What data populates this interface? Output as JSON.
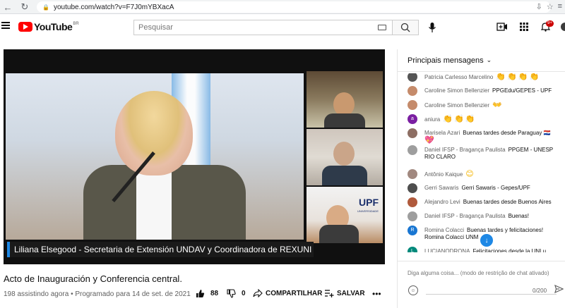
{
  "browser": {
    "url": "youtube.com/watch?v=F7J0mYBXacA"
  },
  "header": {
    "logo_text": "YouTube",
    "country": "BR",
    "search_placeholder": "Pesquisar",
    "notif_count": "9+"
  },
  "video": {
    "caption": "Liliana Elsegood - Secretaria de Extensión UNDAV y Coordinadora de REXUNI",
    "upf_logo": "UPF",
    "upf_sub": "UNIVERSIDADE"
  },
  "details": {
    "title": "Acto de Inauguración y Conferencia central.",
    "meta": "198 assistindo agora • Programado para 14 de set. de 2021",
    "likes": "88",
    "dislikes": "0",
    "share_label": "COMPARTILHAR",
    "save_label": "SALVAR"
  },
  "chat": {
    "header": "Principais mensagens",
    "messages": [
      {
        "author": "Patricia Carlesso Marcelino",
        "text": "",
        "emoji": "👏👏👏👏",
        "avatar_color": "#555555"
      },
      {
        "author": "Caroline Simon Bellenzier",
        "text": "PPGEdu/GEPES - UPF",
        "emoji": "",
        "avatar_color": "#c58b6b"
      },
      {
        "author": "Caroline Simon Bellenzier",
        "text": "",
        "emoji": "👐",
        "avatar_color": "#c58b6b"
      },
      {
        "author": "aniura",
        "text": "",
        "emoji": "👏👏👏",
        "avatar_color": "#7b1fa2",
        "avatar_letter": "a"
      },
      {
        "author": "Marisela Azari",
        "text": "Buenas tardes desde Paraguay 🇵🇾",
        "emoji": "💖",
        "avatar_color": "#8d6e63"
      },
      {
        "author": "Daniel IFSP - Bragança Paulista",
        "text": "PPGEM - UNESP",
        "text2": "RIO CLARO",
        "emoji": "",
        "avatar_color": "#9e9e9e"
      },
      {
        "author": "Antônio Kaique",
        "text": "",
        "emoji": "😊",
        "avatar_color": "#a1887f"
      },
      {
        "author": "Gerri Sawaris",
        "text": "Gerri Sawaris - Gepes/UPF",
        "emoji": "",
        "avatar_color": "#4e4e4e"
      },
      {
        "author": "Alejandro Levi",
        "text": "Buenas tardes desde Buenos Aires",
        "emoji": "",
        "avatar_color": "#b05a3c"
      },
      {
        "author": "Daniel IFSP - Bragança Paulista",
        "text": "Buenas!",
        "emoji": "",
        "avatar_color": "#9e9e9e"
      },
      {
        "author": "Romina Colacci",
        "text": "Buenas tardes y felicitaciones!",
        "text2": "Romina Colacci UNM",
        "emoji": "",
        "avatar_color": "#1976d2",
        "avatar_letter": "R"
      },
      {
        "author": "LUCIANODRONA",
        "text": "Felicitaciones desde la UNLu",
        "emoji": "",
        "avatar_color": "#00897b",
        "avatar_letter": "L"
      }
    ],
    "input_placeholder": "Diga alguma coisa... (modo de restrição de chat ativado)",
    "char_count": "0/200"
  }
}
